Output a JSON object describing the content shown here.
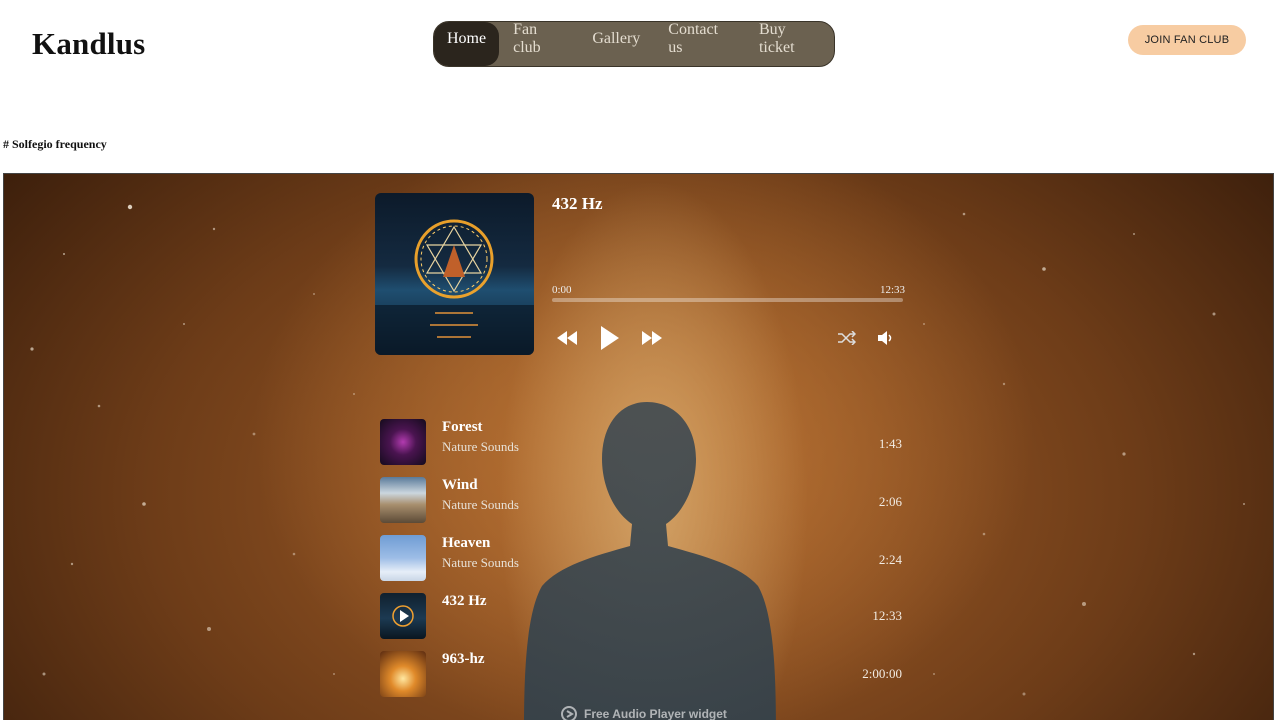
{
  "brand": {
    "logo": "Kandlus"
  },
  "nav": {
    "items": [
      "Home",
      "Fan club",
      "Gallery",
      "Contact us",
      "Buy ticket"
    ],
    "active": "Home"
  },
  "header": {
    "cta": "JOIN FAN CLUB"
  },
  "section": {
    "label": "# Solfegio frequency"
  },
  "player": {
    "now_playing": "432 Hz",
    "time_current": "0:00",
    "time_total": "12:33",
    "progress": 0,
    "icons": [
      "rewind-icon",
      "play-icon",
      "fast-forward-icon",
      "shuffle-icon",
      "volume-icon"
    ]
  },
  "playlist": [
    {
      "title": "Forest",
      "subtitle": "Nature Sounds",
      "duration": "1:43"
    },
    {
      "title": "Wind",
      "subtitle": "Nature Sounds",
      "duration": "2:06"
    },
    {
      "title": "Heaven",
      "subtitle": "Nature Sounds",
      "duration": "2:24"
    },
    {
      "title": "432 Hz",
      "subtitle": "",
      "duration": "12:33",
      "playing": true
    },
    {
      "title": "963-hz",
      "subtitle": "",
      "duration": "2:00:00"
    }
  ],
  "footer": {
    "brand": "Free Audio Player widget"
  },
  "colors": {
    "nav_bg": "#6b6150",
    "nav_active": "#2b251d",
    "cta_bg": "#f7cca2",
    "text_light": "#ffffff"
  }
}
